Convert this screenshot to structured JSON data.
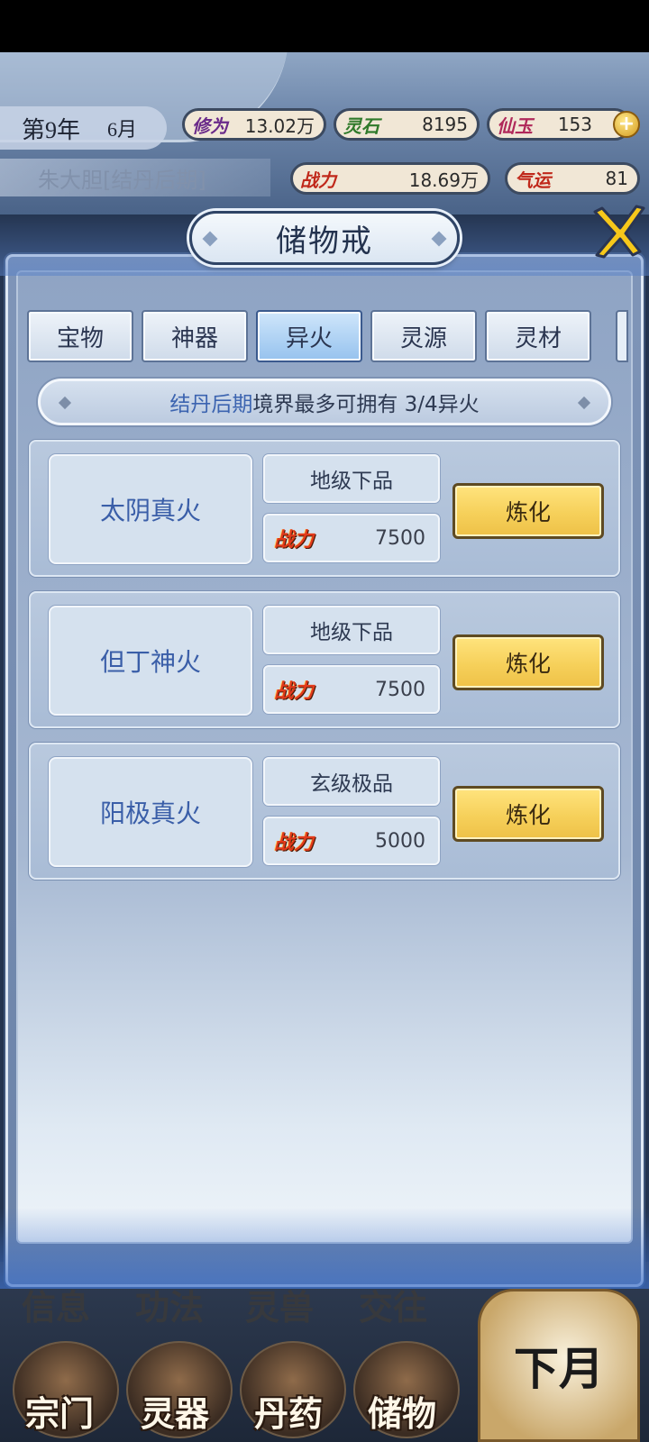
{
  "hud": {
    "year": "第9年",
    "month": "6月",
    "player_name": "朱大胆",
    "player_realm": "[结丹后期]",
    "cultivation": {
      "label": "修为",
      "value": "13.02万"
    },
    "spirit_stone": {
      "label": "灵石",
      "value": "8195"
    },
    "jade": {
      "label": "仙玉",
      "value": "153"
    },
    "combat_power": {
      "label": "战力",
      "value": "18.69万"
    },
    "luck": {
      "label": "气运",
      "value": "81"
    },
    "plus_symbol": "+"
  },
  "modal": {
    "title": "储物戒",
    "tabs": [
      {
        "label": "宝物",
        "active": false
      },
      {
        "label": "神器",
        "active": false
      },
      {
        "label": "异火",
        "active": true
      },
      {
        "label": "灵源",
        "active": false
      },
      {
        "label": "灵材",
        "active": false
      }
    ],
    "info": {
      "realm": "结丹后期",
      "text": "境界最多可拥有 3/4异火"
    },
    "items": [
      {
        "name": "太阴真火",
        "grade": "地级下品",
        "power_label": "战力",
        "power": "7500",
        "action": "炼化"
      },
      {
        "name": "但丁神火",
        "grade": "地级下品",
        "power_label": "战力",
        "power": "7500",
        "action": "炼化"
      },
      {
        "name": "阳极真火",
        "grade": "玄级极品",
        "power_label": "战力",
        "power": "5000",
        "action": "炼化"
      }
    ]
  },
  "bottom_nav": {
    "top_row": [
      "信息",
      "功法",
      "灵兽",
      "交往"
    ],
    "items": [
      "宗门",
      "灵器",
      "丹药",
      "储物"
    ],
    "next_month": "下月"
  },
  "colors": {
    "accent_blue": "#3c64b0",
    "gold_button": "#f6d05a",
    "power_red": "#e23a1c"
  }
}
